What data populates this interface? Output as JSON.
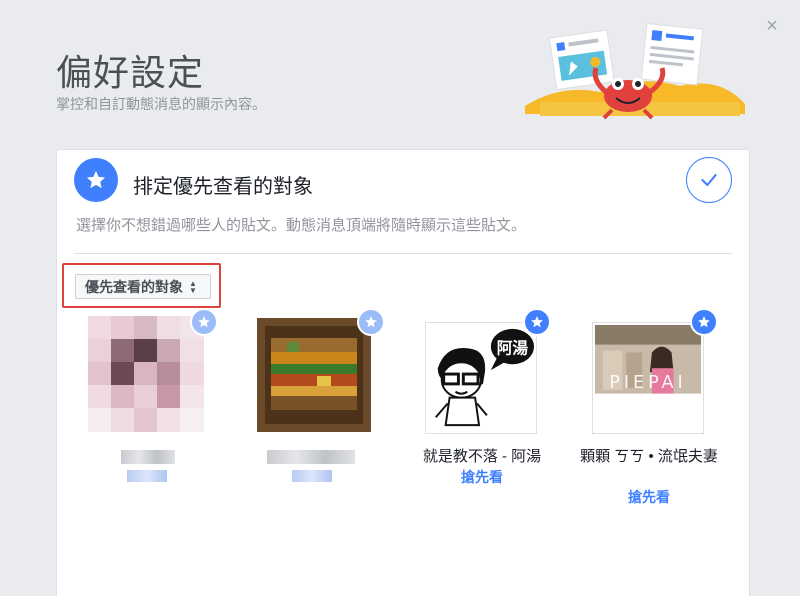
{
  "dialog": {
    "title": "偏好設定",
    "subtitle": "掌控和自訂動態消息的顯示內容。",
    "close_glyph": "×"
  },
  "section": {
    "title": "排定優先查看的對象",
    "description": "選擇你不想錯過哪些人的貼文。動態消息頂端將隨時顯示這些貼文。",
    "icon": "star-icon",
    "confirm_icon": "check-icon"
  },
  "filter": {
    "selected": "優先查看的對象",
    "arrows": "▲▼"
  },
  "people": [
    {
      "name": "",
      "action": "",
      "blurred": true
    },
    {
      "name": "",
      "action": "",
      "blurred": true
    },
    {
      "name": "就是教不落 - 阿湯",
      "action": "搶先看",
      "blurred": false,
      "speech": "阿湯"
    },
    {
      "name": "顆顆 ㄎㄎ • 流氓夫妻",
      "action": "搶先看",
      "blurred": false,
      "overlay_text": "PIEPAI"
    }
  ],
  "colors": {
    "accent": "#4080ff",
    "highlight": "#e0413d",
    "background": "#e9ebee"
  }
}
